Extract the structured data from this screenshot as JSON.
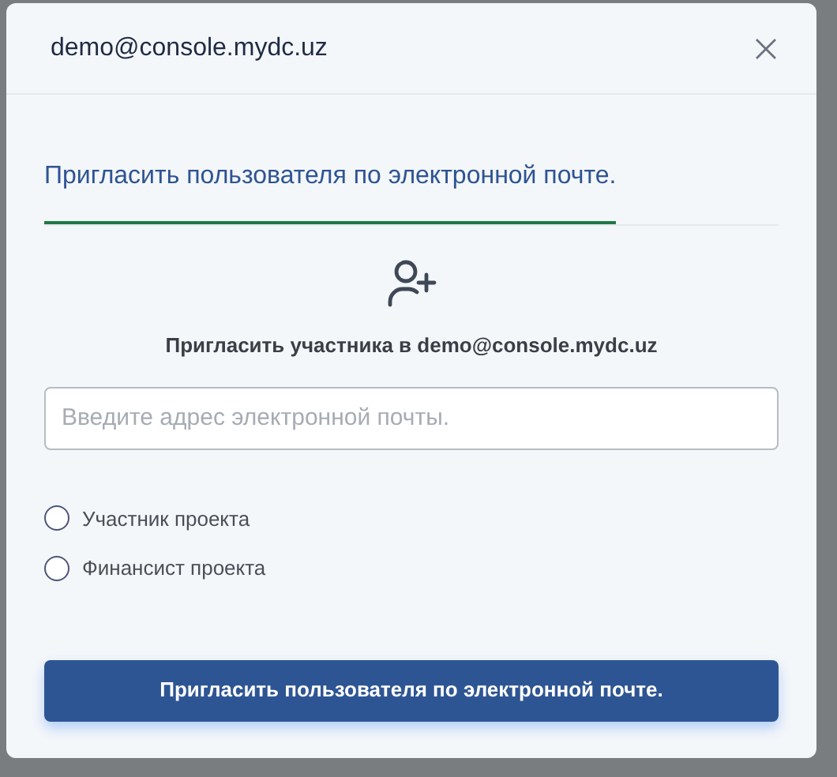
{
  "dialog": {
    "title": "demo@console.mydc.uz"
  },
  "tabs": [
    {
      "label": "Пригласить пользователя по электронной почте.",
      "selected": true
    }
  ],
  "subtitle": "Пригласить участника в demo@console.mydc.uz",
  "email_field": {
    "placeholder": "Введите адрес электронной почты."
  },
  "roles": [
    {
      "label": "Участник проекта",
      "selected": false
    },
    {
      "label": "Финансист проекта",
      "selected": false
    }
  ],
  "submit_button": "Пригласить пользователя по электронной почте."
}
